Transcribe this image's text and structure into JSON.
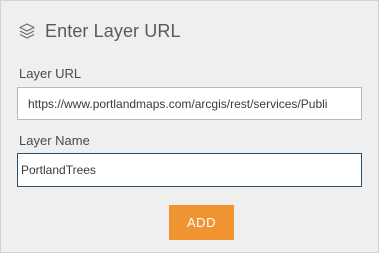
{
  "dialog": {
    "title": "Enter Layer URL",
    "icon": "layers-icon"
  },
  "form": {
    "url_label": "Layer URL",
    "url_value": "https://www.portlandmaps.com/arcgis/rest/services/Publi",
    "name_label": "Layer Name",
    "name_value": "PortlandTrees"
  },
  "actions": {
    "add_label": "ADD"
  },
  "colors": {
    "panel_background": "#efefef",
    "accent": "#ef9430",
    "focused_border": "#2f4f6f"
  }
}
